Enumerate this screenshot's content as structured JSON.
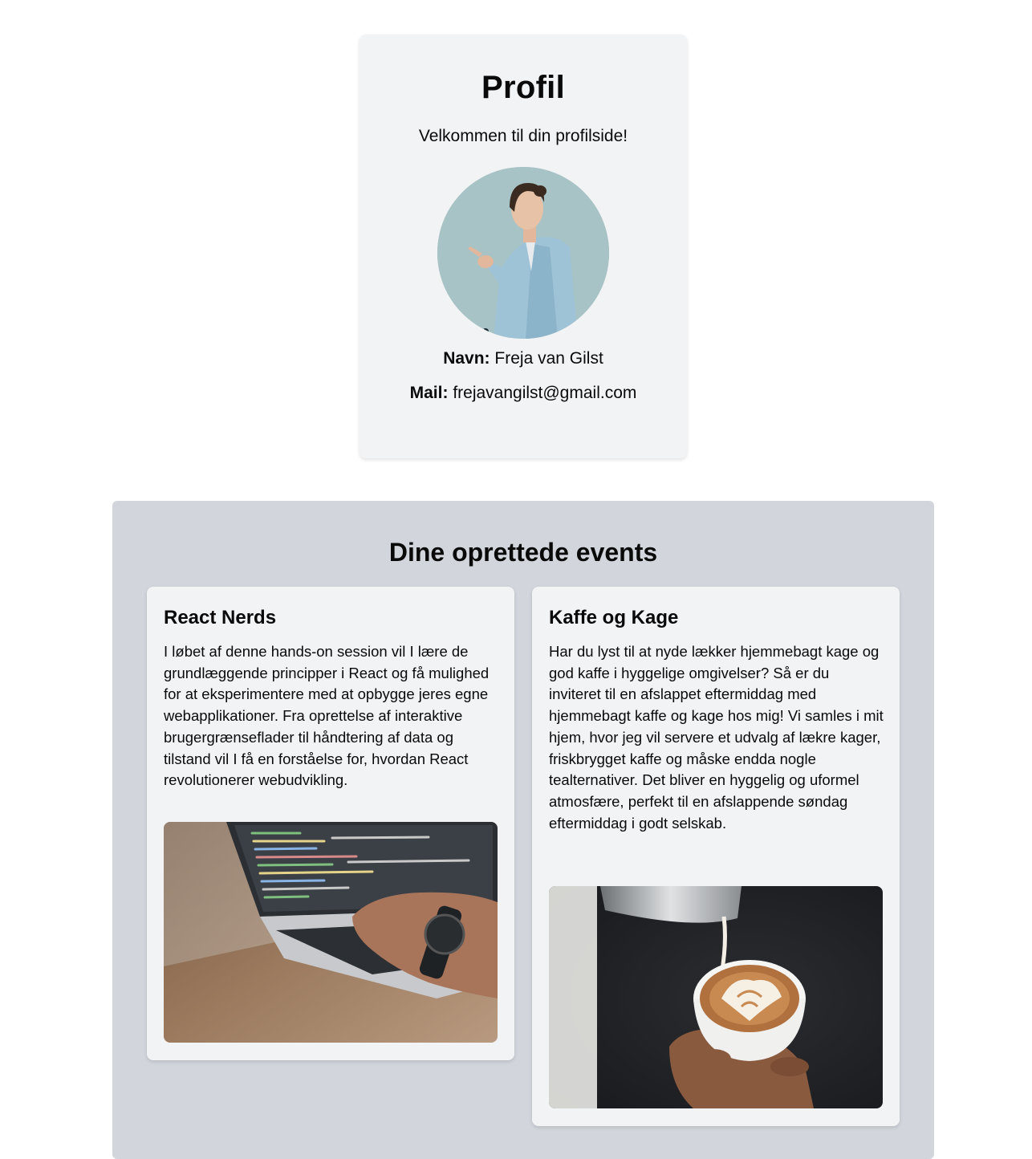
{
  "profile": {
    "title": "Profil",
    "welcome": "Velkommen til din profilside!",
    "avatar_icon": "profile-photo",
    "name_label": "Navn:",
    "name_value": "Freja van Gilst",
    "mail_label": "Mail:",
    "mail_value": "frejavangilst@gmail.com"
  },
  "events": {
    "title": "Dine oprettede events",
    "items": [
      {
        "title": "React Nerds",
        "description": "I løbet af denne hands-on session vil I lære de grundlæggende principper i React og få mulighed for at eksperimentere med at opbygge jeres egne webapplikationer. Fra oprettelse af interaktive brugergrænseflader til håndtering af data og tilstand vil I få en forståelse for, hvordan React revolutionerer webudvikling.",
        "image_icon": "laptop-coding-photo"
      },
      {
        "title": "Kaffe og Kage",
        "description": "Har du lyst til at nyde lækker hjemmebagt kage og god kaffe i hyggelige omgivelser? Så er du inviteret til en afslappet eftermiddag med hjemmebagt kaffe og kage hos mig! Vi samles i mit hjem, hvor jeg vil servere et udvalg af lækre kager, friskbrygget kaffe og måske endda nogle tealternativer. Det bliver en hyggelig og uformel atmosfære, perfekt til en afslappende søndag eftermiddag i godt selskab.",
        "image_icon": "latte-art-photo"
      }
    ]
  },
  "colors": {
    "page_bg": "#ffffff",
    "card_bg": "#f2f3f5",
    "panel_bg": "#d2d5dc",
    "text": "#0a0a0a"
  }
}
